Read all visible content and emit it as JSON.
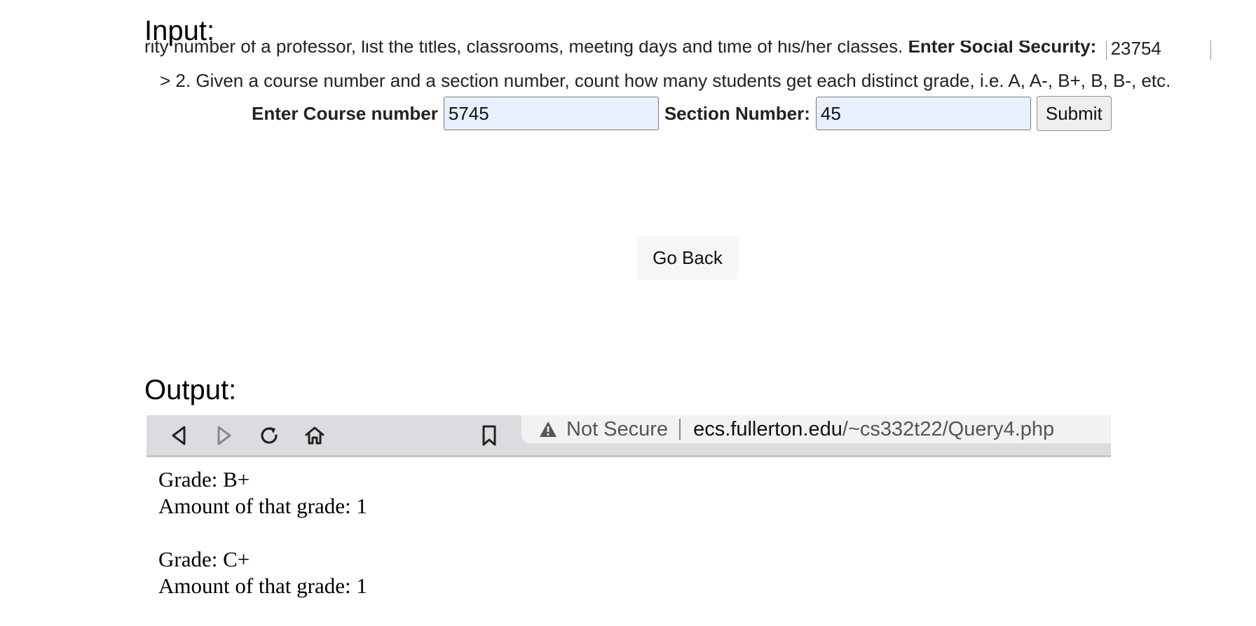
{
  "input_heading": "Input:",
  "query1": {
    "text_fragment": "rity number of a professor, list the titles, classrooms, meeting days and time of his/her classes.",
    "label_fragment": "Enter Social Security:",
    "value_fragment": "23754"
  },
  "query2": {
    "description": "> 2. Given a course number and a section number, count how many students get each distinct grade, i.e. A, A-, B+, B, B-, etc.",
    "course_label": "Enter Course number",
    "course_value": "5745",
    "section_label": "Section Number:",
    "section_value": "45",
    "submit_label": "Submit"
  },
  "go_back_label": "Go Back",
  "output_heading": "Output:",
  "browser": {
    "security_text": "Not Secure",
    "url_host": "ecs.fullerton.edu",
    "url_path": "/~cs332t22/Query4.php",
    "icons": [
      "back-icon",
      "forward-icon",
      "reload-icon",
      "home-icon",
      "bookmark-icon",
      "warning-icon"
    ]
  },
  "results": [
    {
      "grade_line": "Grade: B+",
      "amount_line": "Amount of that grade: 1"
    },
    {
      "grade_line": "Grade: C+",
      "amount_line": "Amount of that grade: 1"
    }
  ]
}
